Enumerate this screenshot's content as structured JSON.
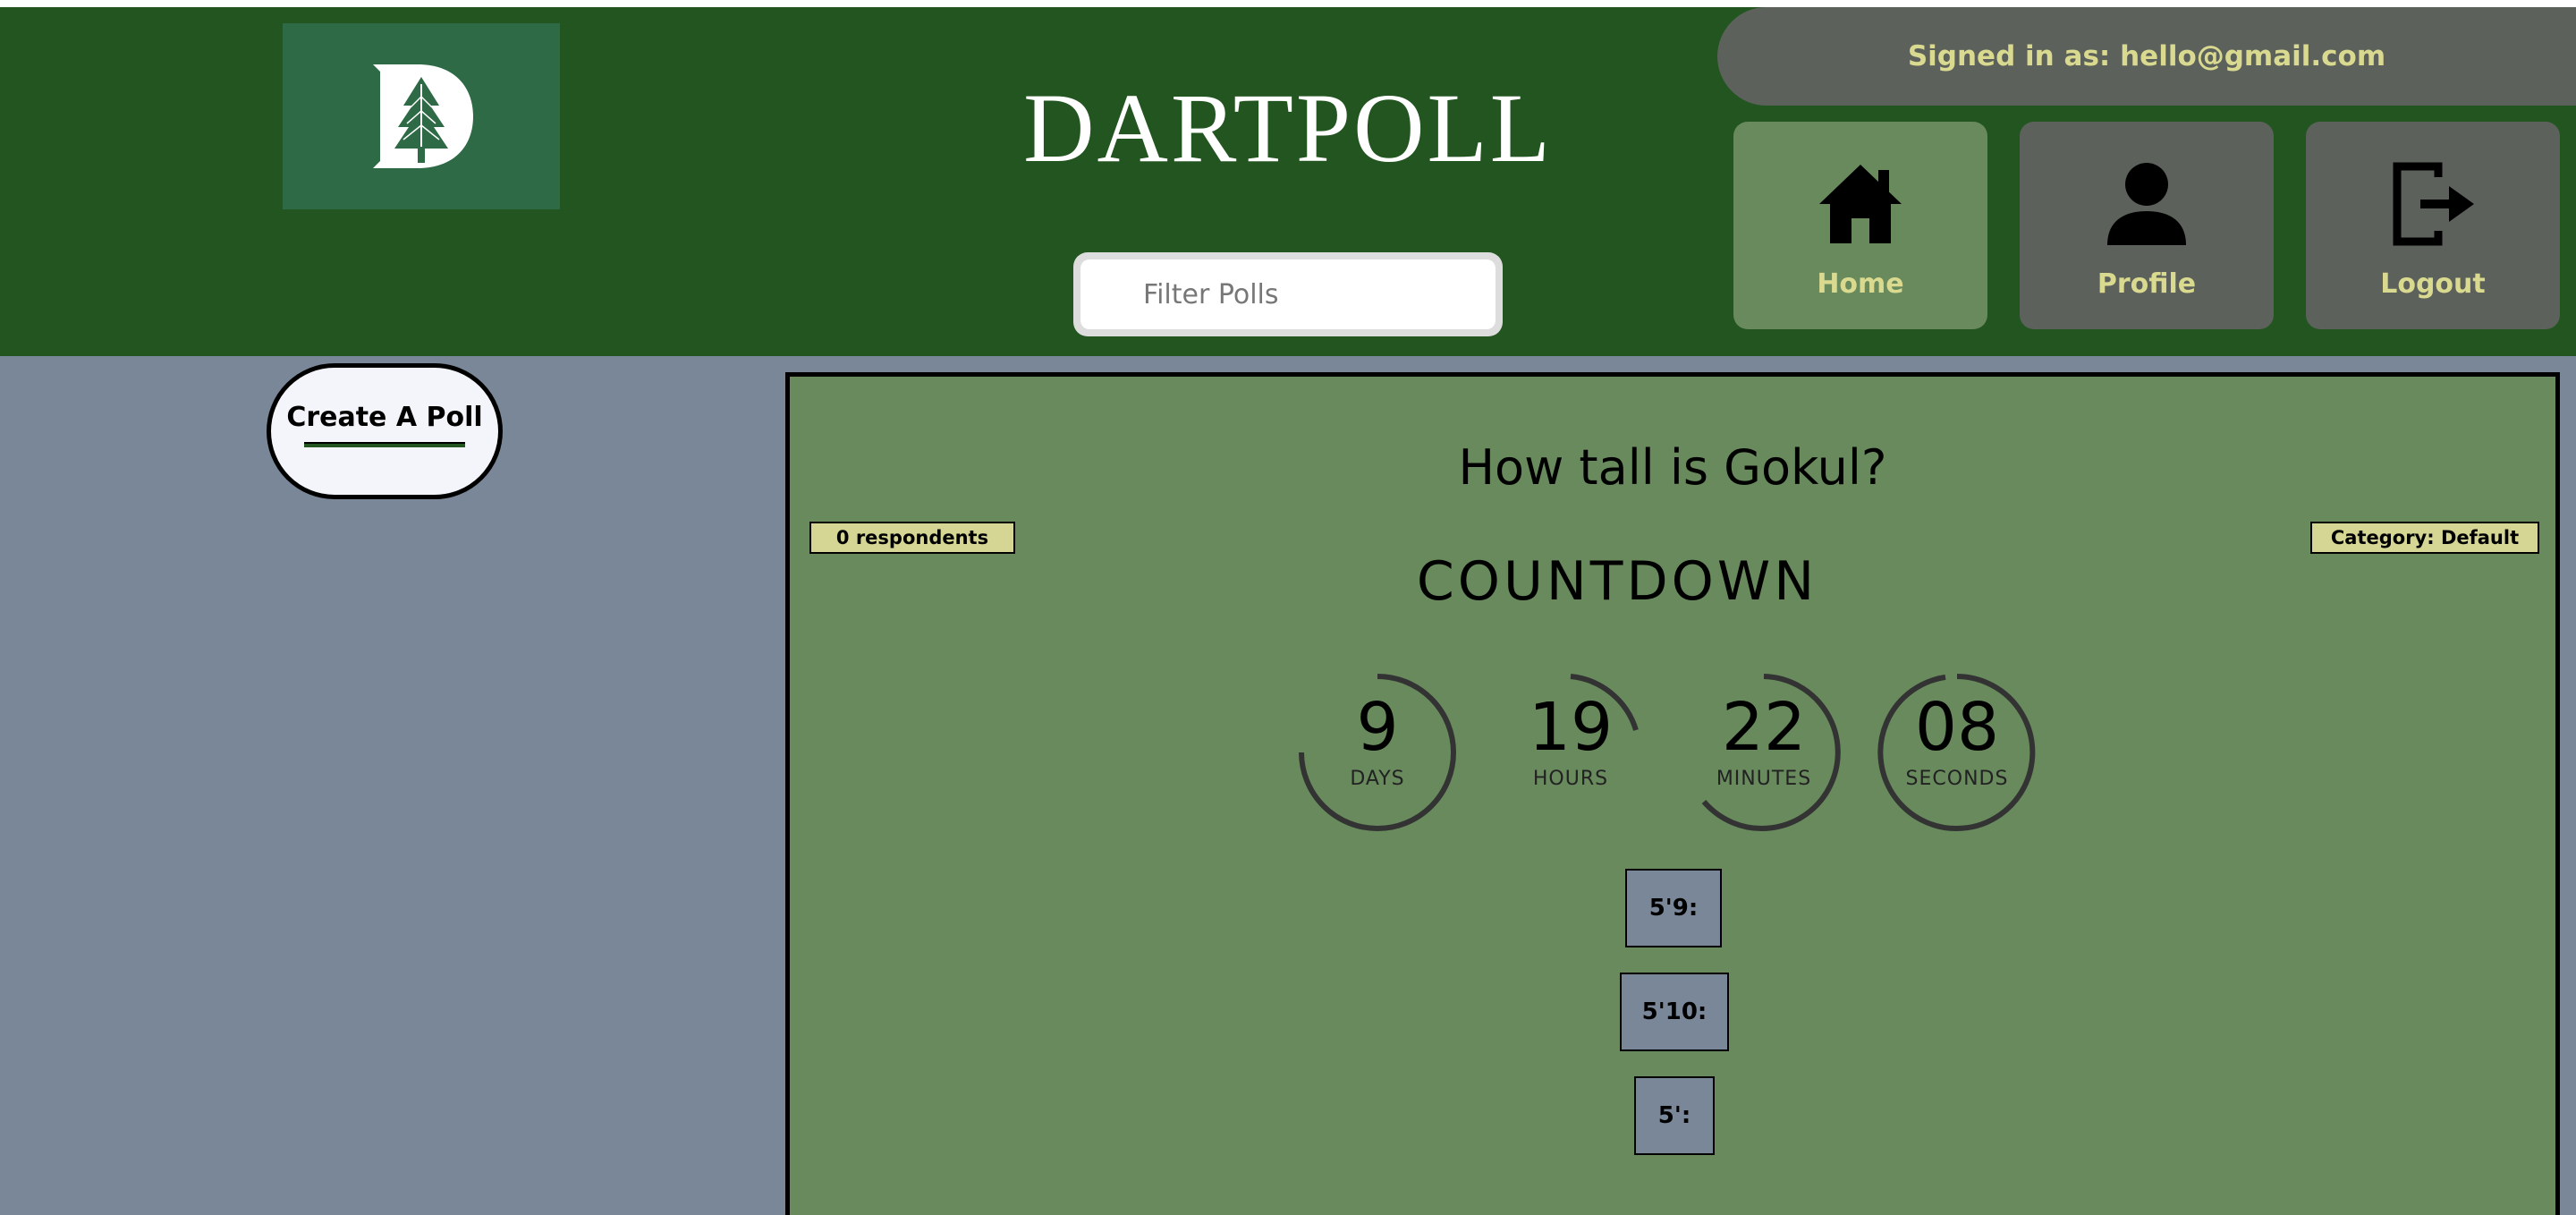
{
  "header": {
    "app_title": "DARTPOLL",
    "logo_letter": "D",
    "search_placeholder": "Filter Polls",
    "signed_in_text": "Signed in as: hello@gmail.com"
  },
  "nav": {
    "home_label": "Home",
    "profile_label": "Profile",
    "logout_label": "Logout"
  },
  "sidebar": {
    "create_label": "Create A Poll"
  },
  "poll": {
    "question": "How tall is Gokul?",
    "respondents": "0 respondents",
    "category": "Category: Default",
    "countdown_title": "COUNTDOWN",
    "timers": {
      "days": {
        "value": "9",
        "unit": "DAYS"
      },
      "hours": {
        "value": "19",
        "unit": "HOURS"
      },
      "minutes": {
        "value": "22",
        "unit": "MINUTES"
      },
      "seconds": {
        "value": "08",
        "unit": "SECONDS"
      }
    },
    "options": [
      "5'9:",
      "5'10:",
      "5':"
    ]
  },
  "colors": {
    "header_bg": "#235520",
    "body_bg": "#7a8798",
    "card_bg": "#688a5d",
    "badge_bg": "#d5d594",
    "nav_active": "#688a5d",
    "nav_inactive": "#5c615b",
    "accent_text": "#d9d98f"
  }
}
